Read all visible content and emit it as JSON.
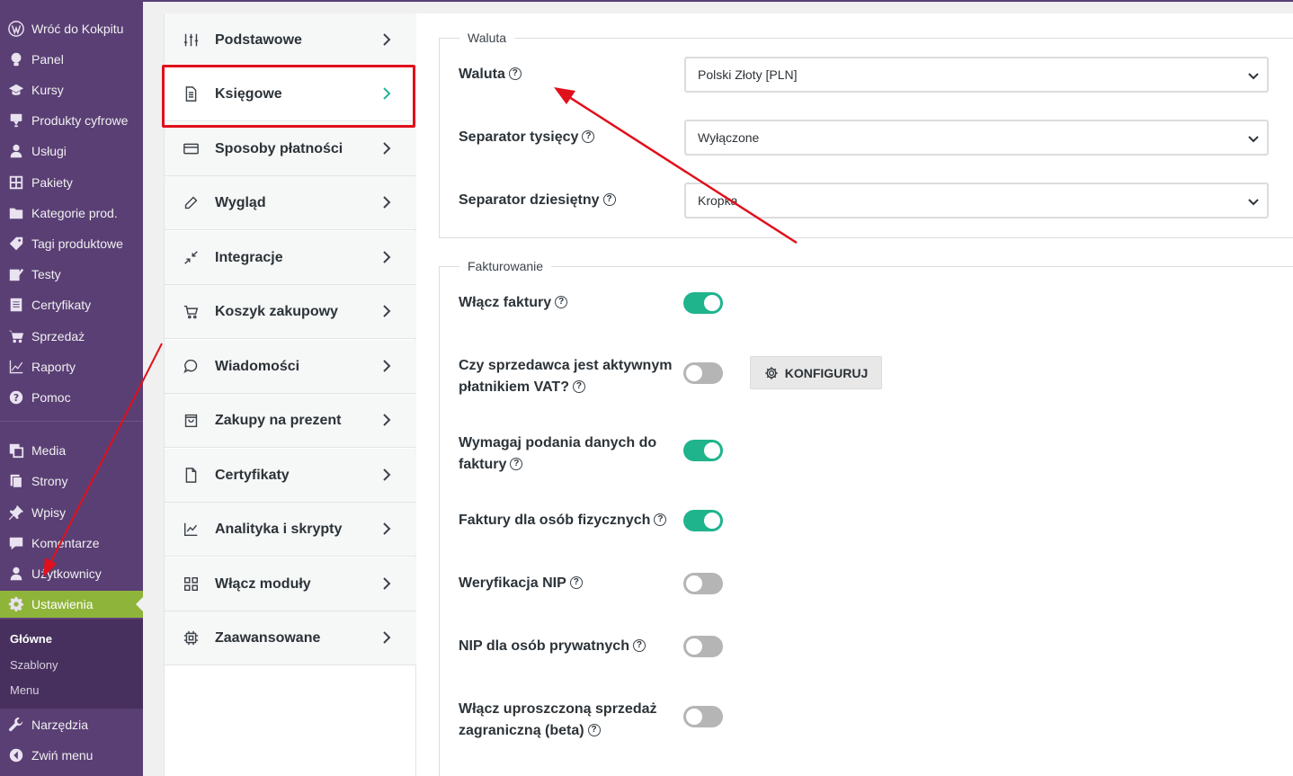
{
  "sidebar": {
    "items": [
      {
        "label": "Wróć do Kokpitu",
        "icon": "wordpress-icon"
      },
      {
        "label": "Panel",
        "icon": "lightbulb-icon"
      },
      {
        "label": "Kursy",
        "icon": "graduation-cap-icon"
      },
      {
        "label": "Produkty cyfrowe",
        "icon": "download-icon"
      },
      {
        "label": "Usługi",
        "icon": "user-group-icon"
      },
      {
        "label": "Pakiety",
        "icon": "grid-icon"
      },
      {
        "label": "Kategorie prod.",
        "icon": "folder-icon"
      },
      {
        "label": "Tagi produktowe",
        "icon": "tag-icon"
      },
      {
        "label": "Testy",
        "icon": "edit-icon"
      },
      {
        "label": "Certyfikaty",
        "icon": "document-icon"
      },
      {
        "label": "Sprzedaż",
        "icon": "cart-icon"
      },
      {
        "label": "Raporty",
        "icon": "chart-icon"
      },
      {
        "label": "Pomoc",
        "icon": "help-icon"
      },
      {
        "label": "Media",
        "icon": "media-icon"
      },
      {
        "label": "Strony",
        "icon": "pages-icon"
      },
      {
        "label": "Wpisy",
        "icon": "pin-icon"
      },
      {
        "label": "Komentarze",
        "icon": "comment-icon"
      },
      {
        "label": "Użytkownicy",
        "icon": "user-icon"
      },
      {
        "label": "Ustawienia",
        "icon": "settings-icon"
      },
      {
        "label": "Narzędzia",
        "icon": "wrench-icon"
      },
      {
        "label": "Zwiń menu",
        "icon": "collapse-icon"
      }
    ],
    "submenu": [
      "Główne",
      "Szablony",
      "Menu"
    ]
  },
  "settings_nav": [
    {
      "label": "Podstawowe",
      "icon": "sliders-icon"
    },
    {
      "label": "Księgowe",
      "icon": "document-icon"
    },
    {
      "label": "Sposoby płatności",
      "icon": "card-icon"
    },
    {
      "label": "Wygląd",
      "icon": "pencil-icon"
    },
    {
      "label": "Integracje",
      "icon": "arrows-in-icon"
    },
    {
      "label": "Koszyk zakupowy",
      "icon": "cart-icon"
    },
    {
      "label": "Wiadomości",
      "icon": "chat-icon"
    },
    {
      "label": "Zakupy na prezent",
      "icon": "bag-icon"
    },
    {
      "label": "Certyfikaty",
      "icon": "file-icon"
    },
    {
      "label": "Analityka i skrypty",
      "icon": "chart-icon"
    },
    {
      "label": "Włącz moduły",
      "icon": "modules-icon"
    },
    {
      "label": "Zaawansowane",
      "icon": "chip-icon"
    }
  ],
  "currency_section": {
    "legend": "Waluta",
    "rows": [
      {
        "label": "Waluta",
        "value": "Polski Złoty [PLN]"
      },
      {
        "label": "Separator tysięcy",
        "value": "Wyłączone"
      },
      {
        "label": "Separator dziesiętny",
        "value": "Kropka"
      }
    ]
  },
  "invoice_section": {
    "legend": "Fakturowanie",
    "rows": [
      {
        "line1": "Włącz faktury",
        "line2": "",
        "enabled": true
      },
      {
        "line1": "Czy sprzedawca jest aktywnym",
        "line2": "płatnikiem VAT?",
        "enabled": false
      },
      {
        "line1": "Wymagaj podania danych do",
        "line2": "faktury",
        "enabled": true
      },
      {
        "line1": "Faktury dla osób fizycznych",
        "line2": "",
        "enabled": true
      },
      {
        "line1": "Weryfikacja NIP",
        "line2": "",
        "enabled": false
      },
      {
        "line1": "NIP dla osób prywatnych",
        "line2": "",
        "enabled": false
      },
      {
        "line1": "Włącz uproszczoną sprzedaż",
        "line2": "zagraniczną (beta)",
        "enabled": false
      }
    ],
    "configure_label": "KONFIGURUJ"
  },
  "help_glyph": "?",
  "colors": {
    "sidebar": "#5a3f74",
    "active_menu": "#8fb43a",
    "toggle_on": "#1fb48c",
    "annotation": "#e0101c"
  }
}
